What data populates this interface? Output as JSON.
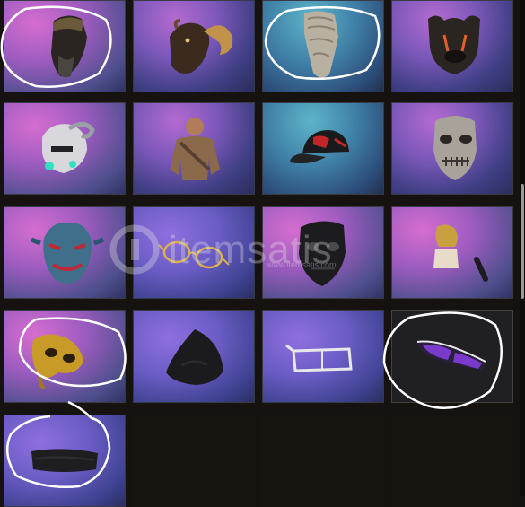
{
  "watermark": {
    "brand": "itemsatis",
    "url": "www.itemsatis.com"
  },
  "colors": {
    "annotation_circle": "#ffffff",
    "scroll_thumb": "#9a9a9a"
  },
  "grid": {
    "items": [
      {
        "name": "bandana-head-wrap",
        "icon": "head-wrap-icon",
        "bg": "pink",
        "circled": true
      },
      {
        "name": "ram-horn-mask",
        "icon": "ram-mask-icon",
        "bg": "purple",
        "circled": false
      },
      {
        "name": "ragged-face-wrap",
        "icon": "ragged-wrap-icon",
        "bg": "teal",
        "circled": true
      },
      {
        "name": "bulldog-mask",
        "icon": "bulldog-mask-icon",
        "bg": "purple",
        "circled": false
      },
      {
        "name": "cyber-mask",
        "icon": "cyber-mask-icon",
        "bg": "pink",
        "circled": false
      },
      {
        "name": "camo-outfit",
        "icon": "outfit-icon",
        "bg": "purple",
        "circled": false
      },
      {
        "name": "baseball-cap",
        "icon": "cap-icon",
        "bg": "teal",
        "circled": false
      },
      {
        "name": "stitched-skull-mask",
        "icon": "skull-mask-icon",
        "bg": "purple",
        "circled": false
      },
      {
        "name": "oni-mask",
        "icon": "oni-mask-icon",
        "bg": "pink",
        "circled": false
      },
      {
        "name": "round-glasses",
        "icon": "glasses-icon",
        "bg": "violet",
        "circled": false
      },
      {
        "name": "black-skull-mask",
        "icon": "black-mask-icon",
        "bg": "pink",
        "circled": false
      },
      {
        "name": "gold-top-outfit",
        "icon": "top-icon",
        "bg": "pink",
        "circled": false
      },
      {
        "name": "gold-masquerade-mask",
        "icon": "masquerade-mask-icon",
        "bg": "pink",
        "circled": true
      },
      {
        "name": "black-hood",
        "icon": "hood-icon",
        "bg": "violet",
        "circled": false
      },
      {
        "name": "white-sport-glasses",
        "icon": "sport-glasses-icon",
        "bg": "violet",
        "circled": false
      },
      {
        "name": "purple-sunglasses",
        "icon": "sunglasses-icon",
        "bg": "dark",
        "circled": true
      },
      {
        "name": "black-headband",
        "icon": "headband-icon",
        "bg": "violet",
        "circled": true
      }
    ]
  }
}
